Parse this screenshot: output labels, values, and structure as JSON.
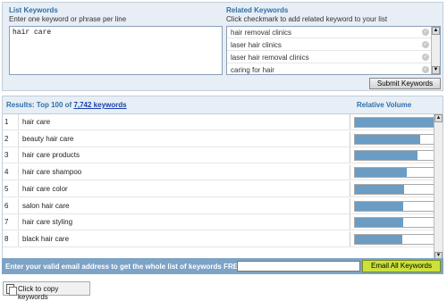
{
  "keywords_panel": {
    "title": "List Keywords",
    "subtitle": "Enter one keyword or phrase per line",
    "textarea_value": "hair care"
  },
  "related_panel": {
    "title": "Related Keywords",
    "subtitle": "Click checkmark to add related keyword to your list",
    "items": [
      "hair removal clinics",
      "laser hair clinics",
      "laser hair removal clinics",
      "caring for hair"
    ],
    "check_icon": "checkmark-icon",
    "check_color": "#c9c9c9"
  },
  "submit_label": "Submit Keywords",
  "results": {
    "prefix": "Results: Top 100 of",
    "count_link": "7,742 keywords",
    "volume_header": "Relative Volume",
    "bar_color": "#6a9cc4",
    "rows": [
      {
        "num": "1",
        "keyword": "hair care",
        "volume": 1.0
      },
      {
        "num": "2",
        "keyword": "beauty hair care",
        "volume": 0.83
      },
      {
        "num": "3",
        "keyword": "hair care products",
        "volume": 0.8
      },
      {
        "num": "4",
        "keyword": "hair care shampoo",
        "volume": 0.66
      },
      {
        "num": "5",
        "keyword": "hair care color",
        "volume": 0.62
      },
      {
        "num": "6",
        "keyword": "salon hair care",
        "volume": 0.61
      },
      {
        "num": "7",
        "keyword": "hair care styling",
        "volume": 0.61
      },
      {
        "num": "8",
        "keyword": "black hair care",
        "volume": 0.6
      }
    ]
  },
  "email_bar": {
    "text": "Enter your valid email address to get the whole list of keywords FREE!",
    "input_value": "",
    "button_label": "Email All Keywords",
    "button_color": "#cce23a"
  },
  "copy_button_label": "Click to copy keywords",
  "copy_icon": "copy-icon"
}
